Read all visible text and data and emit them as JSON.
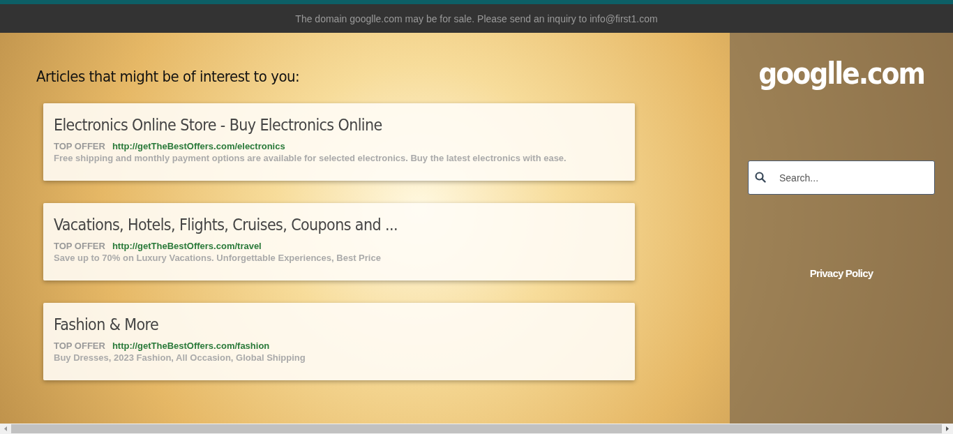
{
  "banner": {
    "text": "The domain googlle.com may be for sale. Please send an inquiry to info@first1.com"
  },
  "articles": {
    "heading": "Articles that might be of interest to you:",
    "items": [
      {
        "title": "Electronics Online Store - Buy Electronics Online",
        "tag": "TOP OFFER",
        "url": "http://getTheBestOffers.com/electronics",
        "description": "Free shipping and monthly payment options are available for selected electronics. Buy the latest electronics with ease."
      },
      {
        "title": "Vacations, Hotels, Flights, Cruises, Coupons and ...",
        "tag": "TOP OFFER",
        "url": "http://getTheBestOffers.com/travel",
        "description": "Save up to 70% on Luxury Vacations. Unforgettable Experiences, Best Price"
      },
      {
        "title": "Fashion & More",
        "tag": "TOP OFFER",
        "url": "http://getTheBestOffers.com/fashion",
        "description": "Buy Dresses, 2023 Fashion, All Occasion, Global Shipping"
      }
    ]
  },
  "sidebar": {
    "site_name": "googlle.com",
    "search": {
      "placeholder": "Search..."
    },
    "link": "Privacy Policy"
  }
}
